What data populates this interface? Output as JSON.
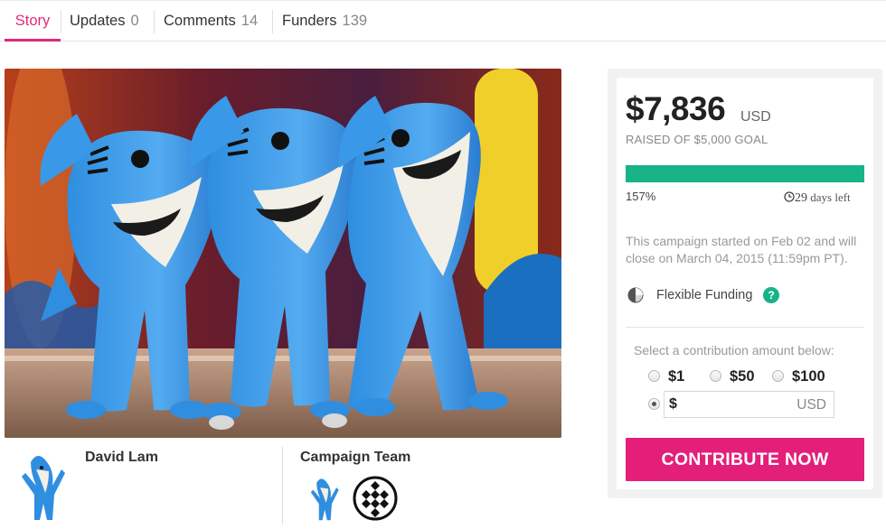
{
  "tabs": [
    {
      "label": "Story",
      "count": ""
    },
    {
      "label": "Updates",
      "count": "0"
    },
    {
      "label": "Comments",
      "count": "14"
    },
    {
      "label": "Funders",
      "count": "139"
    }
  ],
  "hero": {
    "image": "three dancing shark costumes on stage"
  },
  "owner": {
    "name": "David Lam",
    "avatar_icon": "shark-avatar-icon"
  },
  "team": {
    "title": "Campaign Team",
    "members": [
      "shark-avatar-icon",
      "diamond-pattern-avatar-icon"
    ]
  },
  "funding": {
    "amount": "$7,836",
    "currency": "USD",
    "goal_text": "RAISED OF $5,000 GOAL",
    "progress_percent": 100,
    "percent_label": "157%",
    "days_left": "29",
    "days_label": "days left",
    "note": "This campaign started on Feb 02 and will close on March 04, 2015 (11:59pm PT).",
    "funding_type": "Flexible Funding",
    "help": "?"
  },
  "contribution": {
    "prompt": "Select a contribution amount below:",
    "options": [
      "$1",
      "$50",
      "$100"
    ],
    "custom_symbol": "$",
    "custom_value": "",
    "custom_unit": "USD",
    "cta": "CONTRIBUTE NOW"
  },
  "colors": {
    "accent": "#e0297c",
    "cta": "#e31f79",
    "progress": "#19b38a"
  }
}
